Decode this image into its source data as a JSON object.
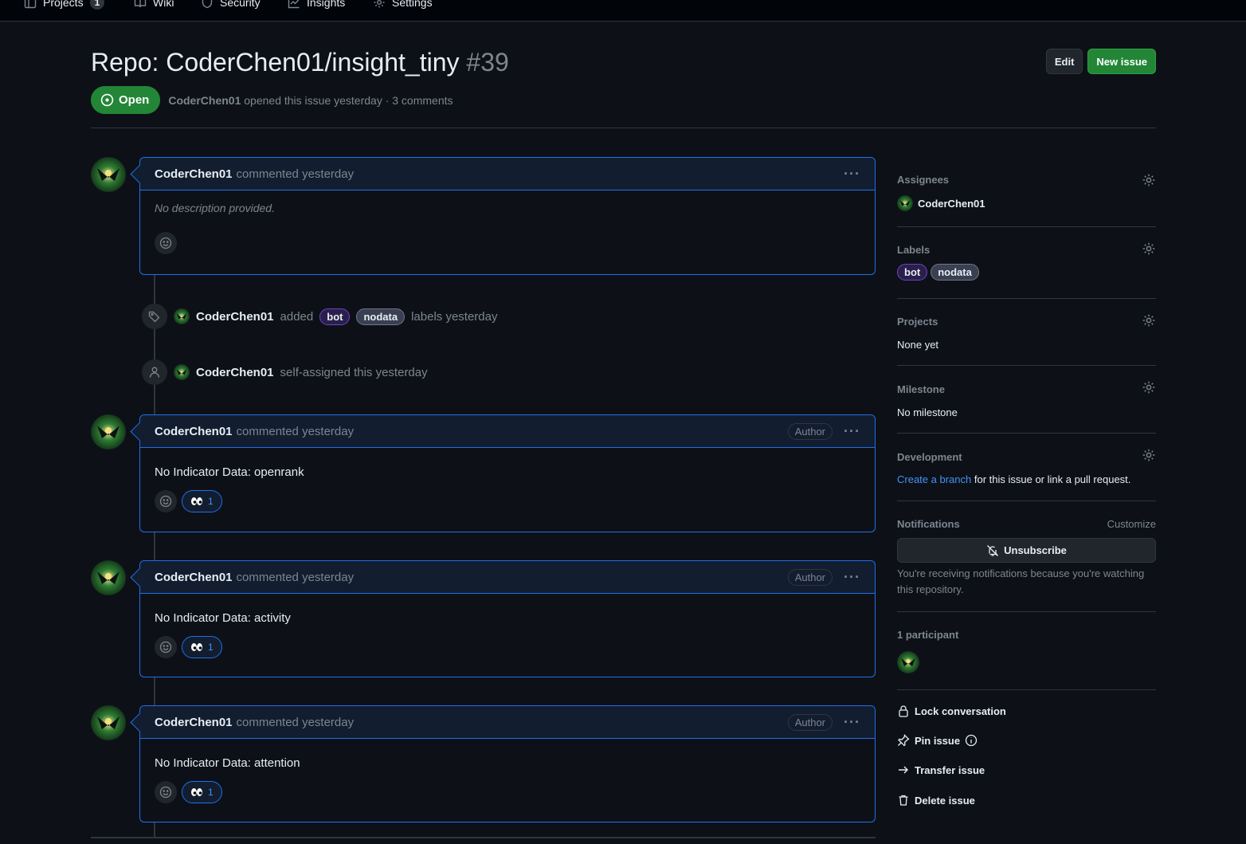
{
  "repo_nav": {
    "tabs": [
      {
        "label": "Projects",
        "count": "1",
        "icon": "table-icon"
      },
      {
        "label": "Wiki",
        "icon": "book-icon"
      },
      {
        "label": "Security",
        "icon": "shield-icon"
      },
      {
        "label": "Insights",
        "icon": "graph-icon"
      },
      {
        "label": "Settings",
        "icon": "gear-icon"
      }
    ]
  },
  "issue": {
    "title": "Repo: CoderChen01/insight_tiny",
    "number": "#39",
    "state": "Open",
    "author": "CoderChen01",
    "opened_text": "opened this issue yesterday · 3 comments",
    "edit_label": "Edit",
    "new_issue_label": "New issue"
  },
  "comments": [
    {
      "author": "CoderChen01",
      "meta": "commented yesterday",
      "body": "No description provided.",
      "is_author_badge": false
    },
    {
      "author": "CoderChen01",
      "meta": "commented yesterday",
      "badge": "Author",
      "body": "No Indicator Data: openrank",
      "reaction_count": "1"
    },
    {
      "author": "CoderChen01",
      "meta": "commented yesterday",
      "badge": "Author",
      "body": "No Indicator Data: activity",
      "reaction_count": "1"
    },
    {
      "author": "CoderChen01",
      "meta": "commented yesterday",
      "badge": "Author",
      "body": "No Indicator Data: attention",
      "reaction_count": "1"
    }
  ],
  "events": {
    "labels": {
      "actor": "CoderChen01",
      "verb": "added",
      "labels": [
        "bot",
        "nodata"
      ],
      "suffix": "labels yesterday"
    },
    "assign": {
      "actor": "CoderChen01",
      "text": "self-assigned this yesterday"
    }
  },
  "sidebar": {
    "assignees": {
      "title": "Assignees",
      "value": "CoderChen01"
    },
    "labels": {
      "title": "Labels",
      "items": [
        "bot",
        "nodata"
      ]
    },
    "projects": {
      "title": "Projects",
      "value": "None yet"
    },
    "milestone": {
      "title": "Milestone",
      "value": "No milestone"
    },
    "development": {
      "title": "Development",
      "link": "Create a branch",
      "text": "for this issue or link a pull request."
    },
    "notifications": {
      "title": "Notifications",
      "customize": "Customize",
      "button": "Unsubscribe",
      "note": "You're receiving notifications because you're watching this repository."
    },
    "participants": {
      "title": "1 participant"
    },
    "actions": {
      "lock": "Lock conversation",
      "pin": "Pin issue",
      "transfer": "Transfer issue",
      "delete": "Delete issue"
    }
  },
  "colors": {
    "accent": "#1f6feb",
    "open": "#238636",
    "link": "#4493f8"
  }
}
